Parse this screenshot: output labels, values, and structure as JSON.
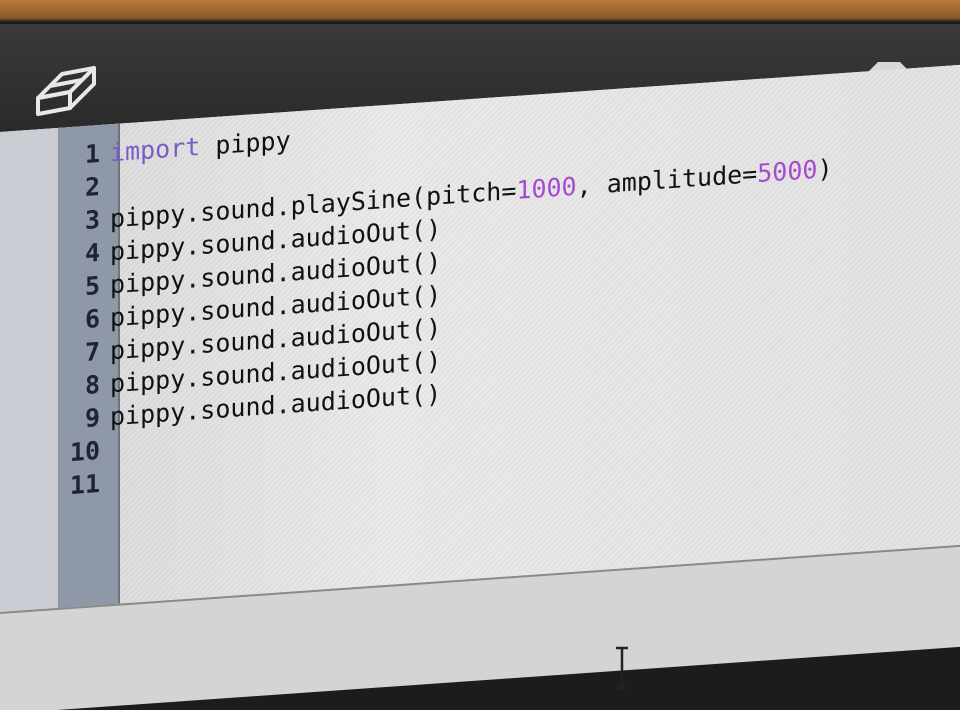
{
  "toolbar": {
    "eraser_icon": "eraser-icon",
    "stop_icon": "stop-icon"
  },
  "editor": {
    "lines": [
      {
        "num": "1",
        "parts": [
          {
            "t": "import",
            "c": "kw"
          },
          {
            "t": " pippy",
            "c": ""
          }
        ]
      },
      {
        "num": "2",
        "parts": [
          {
            "t": "",
            "c": ""
          }
        ]
      },
      {
        "num": "3",
        "parts": [
          {
            "t": "pippy.sound.playSine(pitch=",
            "c": ""
          },
          {
            "t": "1000",
            "c": "num"
          },
          {
            "t": ", amplitude=",
            "c": ""
          },
          {
            "t": "5000",
            "c": "num"
          },
          {
            "t": ")",
            "c": ""
          }
        ]
      },
      {
        "num": "4",
        "parts": [
          {
            "t": "pippy.sound.audioOut()",
            "c": ""
          }
        ]
      },
      {
        "num": "5",
        "parts": [
          {
            "t": "pippy.sound.audioOut()",
            "c": ""
          }
        ]
      },
      {
        "num": "6",
        "parts": [
          {
            "t": "pippy.sound.audioOut()",
            "c": ""
          }
        ]
      },
      {
        "num": "7",
        "parts": [
          {
            "t": "pippy.sound.audioOut()",
            "c": ""
          }
        ]
      },
      {
        "num": "8",
        "parts": [
          {
            "t": "pippy.sound.audioOut()",
            "c": ""
          }
        ]
      },
      {
        "num": "9",
        "parts": [
          {
            "t": "pippy.sound.audioOut()",
            "c": ""
          }
        ]
      },
      {
        "num": "10",
        "parts": [
          {
            "t": "",
            "c": ""
          }
        ]
      },
      {
        "num": "11",
        "parts": [
          {
            "t": "",
            "c": ""
          }
        ]
      }
    ]
  },
  "colors": {
    "keyword": "#7a5cc7",
    "number": "#a64ad0",
    "gutter": "#8f98a6"
  }
}
